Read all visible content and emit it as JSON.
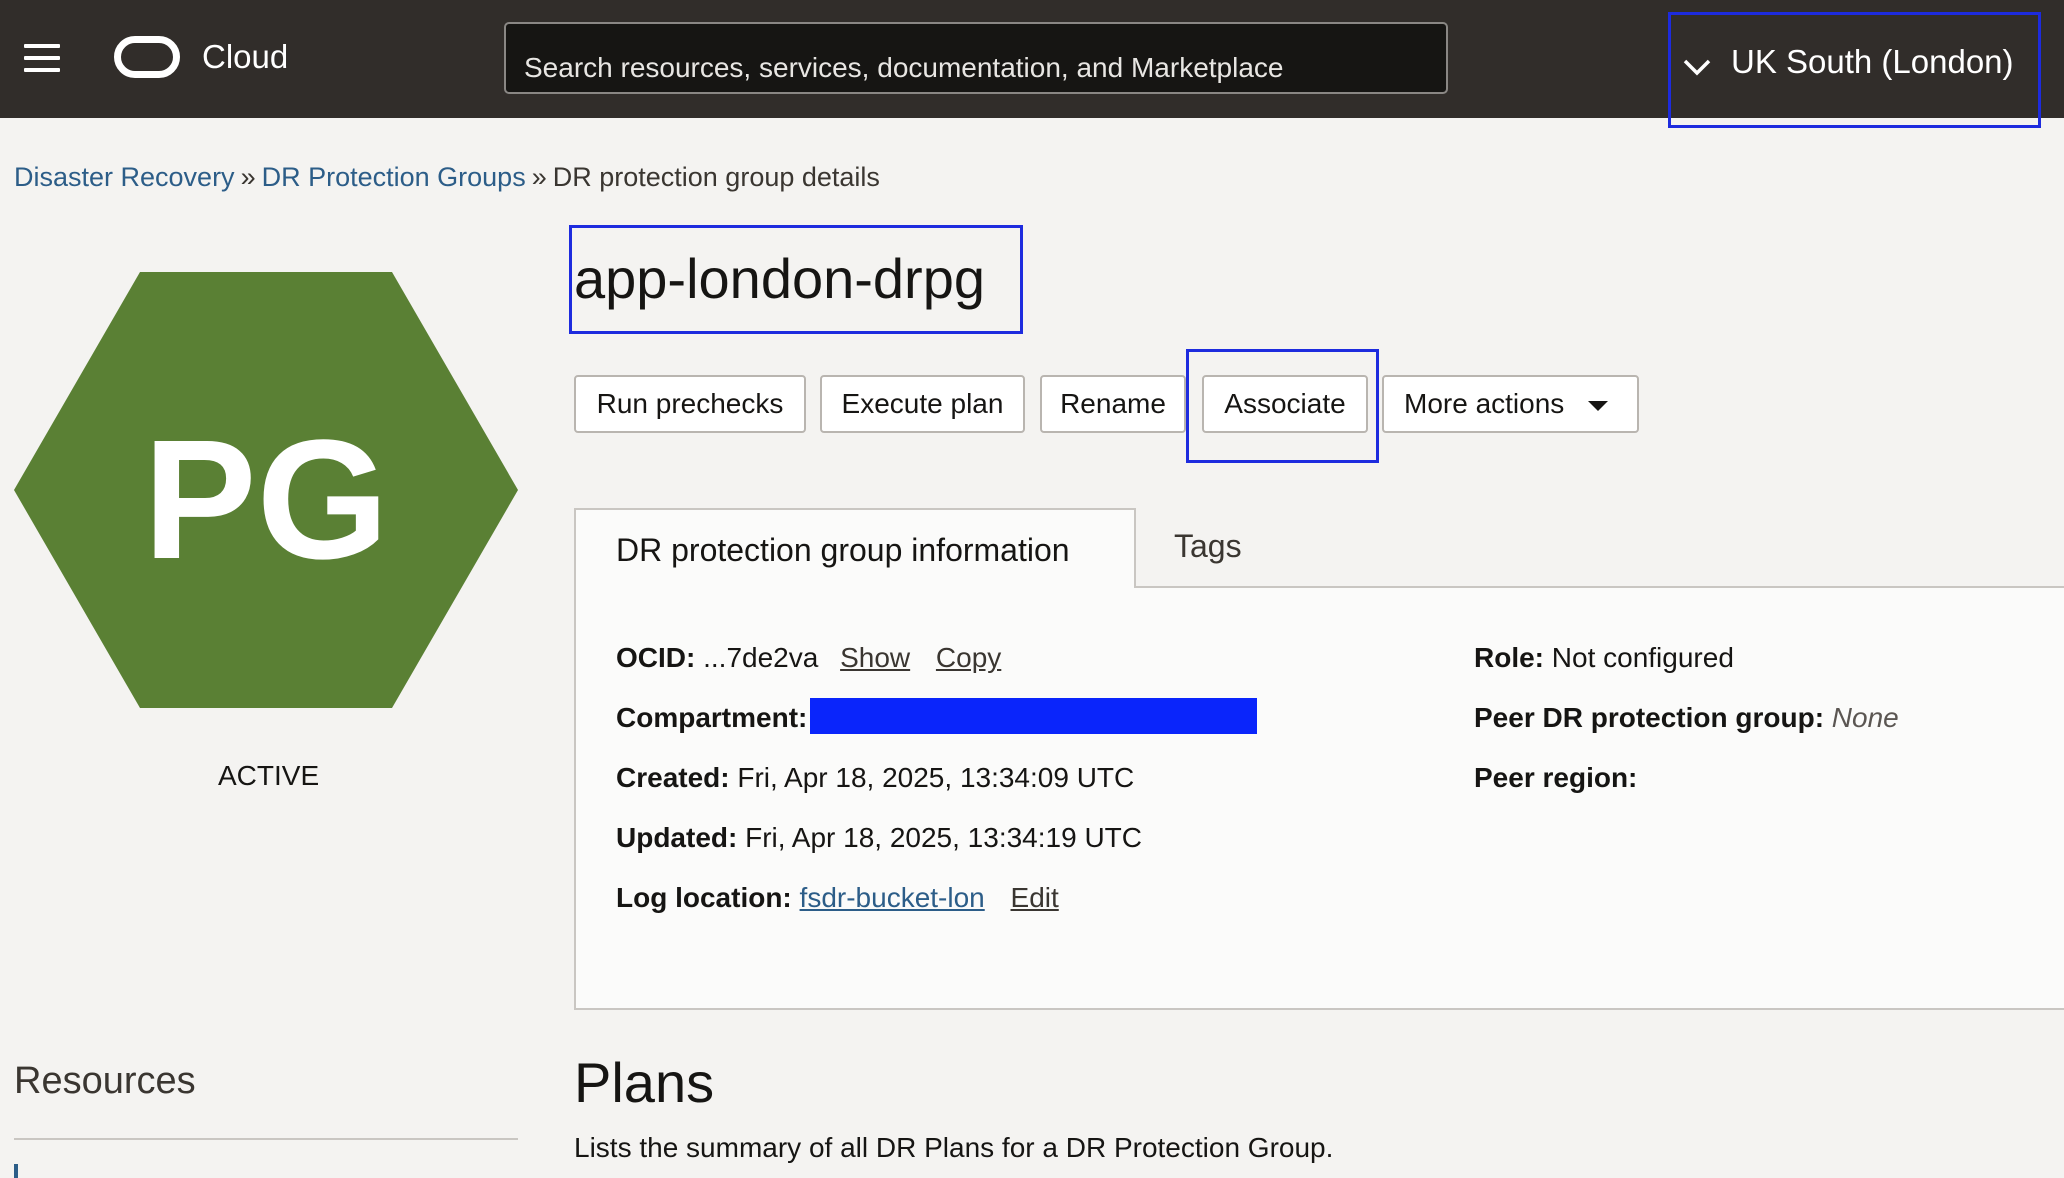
{
  "header": {
    "brand": "Cloud",
    "search_placeholder": "Search resources, services, documentation, and Marketplace",
    "region": "UK South (London)"
  },
  "breadcrumb": {
    "items": [
      "Disaster Recovery",
      "DR Protection Groups"
    ],
    "separator": "»",
    "current": "DR protection group details"
  },
  "resource": {
    "badge_text": "PG",
    "badge_color": "#5a8034",
    "status": "ACTIVE",
    "title": "app-london-drpg"
  },
  "actions": {
    "run_prechecks": "Run prechecks",
    "execute_plan": "Execute plan",
    "rename": "Rename",
    "associate": "Associate",
    "more_actions": "More actions"
  },
  "tabs": [
    "DR protection group information",
    "Tags"
  ],
  "info": {
    "ocid_label": "OCID:",
    "ocid_value": "...7de2va",
    "show": "Show",
    "copy": "Copy",
    "compartment_label": "Compartment:",
    "created_label": "Created:",
    "created_value": "Fri, Apr 18, 2025, 13:34:09 UTC",
    "updated_label": "Updated:",
    "updated_value": "Fri, Apr 18, 2025, 13:34:19 UTC",
    "log_location_label": "Log location:",
    "log_location_value": "fsdr-bucket-lon",
    "edit": "Edit",
    "role_label": "Role:",
    "role_value": "Not configured",
    "peer_group_label": "Peer DR protection group:",
    "peer_group_value": "None",
    "peer_region_label": "Peer region:"
  },
  "sidebar": {
    "resources": "Resources"
  },
  "plans": {
    "title": "Plans",
    "description": "Lists the summary of all DR Plans for a DR Protection Group."
  },
  "colors": {
    "header_bg": "#312d2a",
    "highlight": "#1d2bde",
    "redaction": "#0a25fb",
    "link": "#2c5d88"
  }
}
